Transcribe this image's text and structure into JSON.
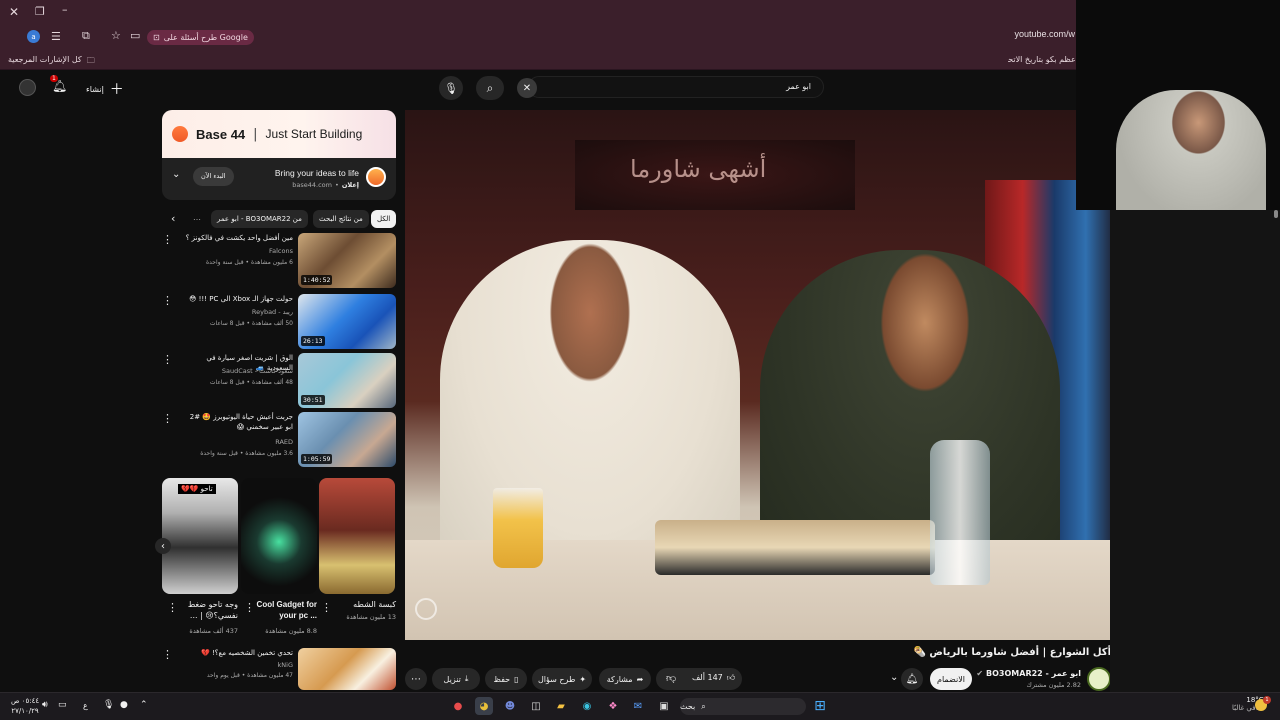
{
  "browser": {
    "url": "youtube.com/w",
    "google_pill": "طرح أسئلة على Google",
    "bookmarks_all": "كل الإشارات المرجعية",
    "bookmark_truncated": "أعظم بكو بتاريخ الاتحا...",
    "profile_letter": "a"
  },
  "youtube": {
    "create_label": "إنشاء",
    "notification_count": "1",
    "search_query": "ابو عمر"
  },
  "ad": {
    "brand": "Base 44",
    "tagline": "Just Start Building",
    "headline": "Bring your ideas to life",
    "sponsor_label": "إعلان",
    "domain": "base44.com",
    "cta": "البدء الآن"
  },
  "chips": [
    {
      "label": "الكل"
    },
    {
      "label": "من نتائج البحث"
    },
    {
      "label": "من BO3OMAR22 - ابو عمر"
    }
  ],
  "related": [
    {
      "title": "مين أفضل واحد يكشت في فالكونز ؟",
      "channel": "Falcons",
      "meta": "6 مليون مشاهدة • قبل سنة واحدة",
      "duration": "1:40:52"
    },
    {
      "title": "حولت جهاز الـ Xbox الى PC !!! 😳",
      "channel": "ريبد - Reybad",
      "meta": "50 ألف مشاهدة • قبل 8 ساعات",
      "duration": "26:13"
    },
    {
      "title": "الوق | شريت اصغر سيارة في السعودية 🚙",
      "channel": "سعود كاست - SaudCast",
      "meta": "48 ألف مشاهدة • قبل 8 ساعات",
      "duration": "30:51"
    },
    {
      "title": "جربت أعيش حياة اليوتيوبرز 🤩 #2 ابو عبير سخمني 😱",
      "channel": "RAED",
      "meta": "3.6 مليون مشاهدة • قبل سنة واحدة",
      "duration": "1:05:59"
    },
    {
      "title": "تحدي تخمين الشخصيه مع؟! 💔",
      "channel": "kNiG",
      "meta": "47 مليون مشاهدة • قبل يوم واحد",
      "duration": ""
    }
  ],
  "shorts": [
    {
      "title": "كبسة الشطه",
      "views": "13 مليون مشاهدة"
    },
    {
      "title": "Cool Gadget for your pc ...",
      "views": "8.8 مليون مشاهدة"
    },
    {
      "title": "وجه تاحو ضغط نفسي؟😢 | ...",
      "views": "437 ألف مشاهدة"
    }
  ],
  "short_badge": "تاحو 💔💔",
  "video": {
    "sign_text": "أشهى شاورما",
    "title": "أكل الشوارع | أفضل شاورما بالرياض 🌯",
    "channel": "ابو عمر - BO3OMAR22",
    "subscribers": "2.82 مليون مشترك",
    "subscribe_label": "الانضمام",
    "likes": "147 ألف",
    "share": "مشاركة",
    "ask": "طرح سؤال",
    "save": "حفظ",
    "download": "تنزيل"
  },
  "taskbar": {
    "search_placeholder": "بحث",
    "temperature": "18°C",
    "weather": "صافي غالبًا",
    "time": "٠٥:٤٤ ص",
    "date": "٢٧/١٠/٢٩",
    "lang": "ع",
    "weather_badge": "1"
  }
}
